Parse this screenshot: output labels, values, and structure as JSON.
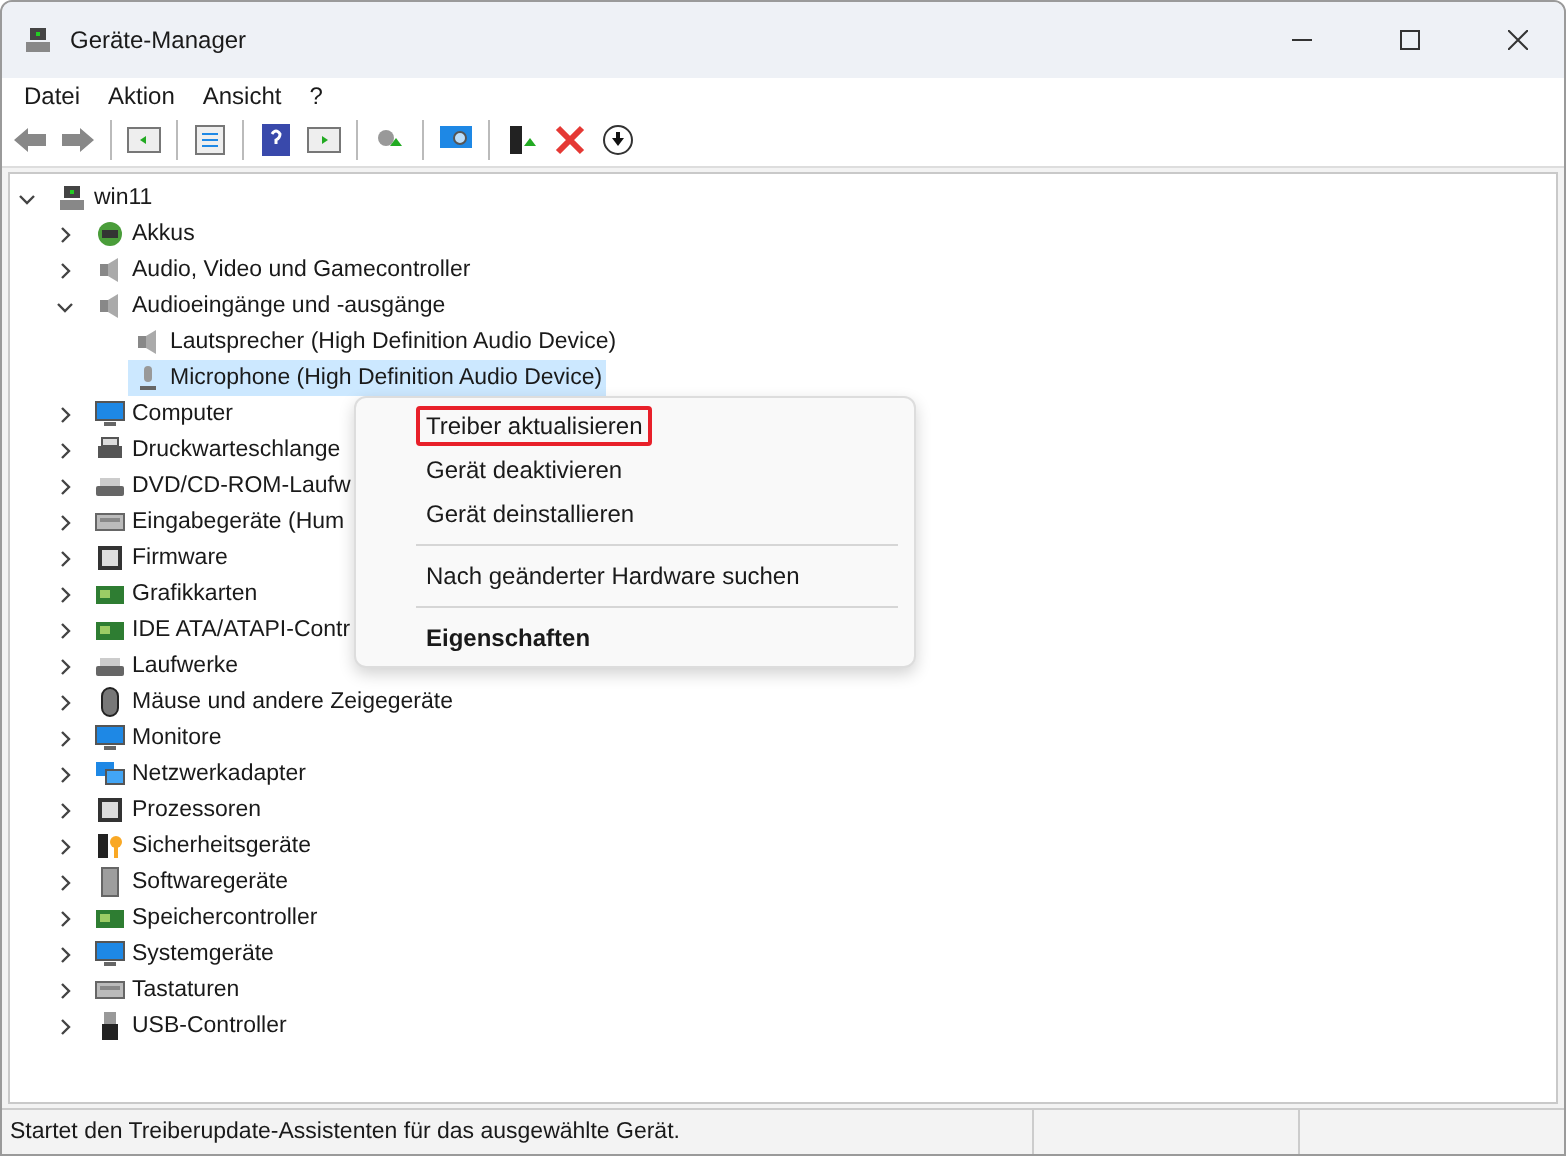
{
  "window": {
    "title": "Geräte-Manager"
  },
  "menubar": [
    "Datei",
    "Aktion",
    "Ansicht",
    "?"
  ],
  "tree": [
    {
      "label": "win11",
      "kind": "computer",
      "expanded": true,
      "selected": false,
      "children": [
        {
          "label": "Akkus",
          "kind": "battery",
          "expanded": false,
          "selected": false
        },
        {
          "label": "Audio, Video und Gamecontroller",
          "kind": "speaker",
          "expanded": false,
          "selected": false
        },
        {
          "label": "Audioeingänge und -ausgänge",
          "kind": "speaker",
          "expanded": true,
          "selected": false,
          "children": [
            {
              "label": "Lautsprecher (High Definition Audio Device)",
              "kind": "speaker",
              "selected": false
            },
            {
              "label": "Microphone (High Definition Audio Device)",
              "kind": "microphone",
              "selected": true
            }
          ]
        },
        {
          "label": "Computer",
          "kind": "monitor",
          "expanded": false,
          "selected": false
        },
        {
          "label": "Druckwarteschlange",
          "kind": "printer",
          "expanded": false,
          "selected": false
        },
        {
          "label": "DVD/CD-ROM-Laufw",
          "kind": "drive",
          "expanded": false,
          "selected": false
        },
        {
          "label": "Eingabegeräte (Hum",
          "kind": "keyboard",
          "expanded": false,
          "selected": false
        },
        {
          "label": "Firmware",
          "kind": "chip",
          "expanded": false,
          "selected": false
        },
        {
          "label": "Grafikkarten",
          "kind": "card",
          "expanded": false,
          "selected": false
        },
        {
          "label": "IDE ATA/ATAPI-Contr",
          "kind": "card",
          "expanded": false,
          "selected": false
        },
        {
          "label": "Laufwerke",
          "kind": "drive",
          "expanded": false,
          "selected": false
        },
        {
          "label": "Mäuse und andere Zeigegeräte",
          "kind": "mouse",
          "expanded": false,
          "selected": false
        },
        {
          "label": "Monitore",
          "kind": "monitor",
          "expanded": false,
          "selected": false
        },
        {
          "label": "Netzwerkadapter",
          "kind": "network",
          "expanded": false,
          "selected": false
        },
        {
          "label": "Prozessoren",
          "kind": "chip",
          "expanded": false,
          "selected": false
        },
        {
          "label": "Sicherheitsgeräte",
          "kind": "key",
          "expanded": false,
          "selected": false
        },
        {
          "label": "Softwaregeräte",
          "kind": "tower",
          "expanded": false,
          "selected": false
        },
        {
          "label": "Speichercontroller",
          "kind": "card",
          "expanded": false,
          "selected": false
        },
        {
          "label": "Systemgeräte",
          "kind": "monitor",
          "expanded": false,
          "selected": false
        },
        {
          "label": "Tastaturen",
          "kind": "keyboard",
          "expanded": false,
          "selected": false
        },
        {
          "label": "USB-Controller",
          "kind": "usb",
          "expanded": false,
          "selected": false
        }
      ]
    }
  ],
  "context_menu": [
    {
      "kind": "item",
      "label": "Treiber aktualisieren",
      "highlighted": true,
      "default": false
    },
    {
      "kind": "item",
      "label": "Gerät deaktivieren",
      "highlighted": false,
      "default": false
    },
    {
      "kind": "item",
      "label": "Gerät deinstallieren",
      "highlighted": false,
      "default": false
    },
    {
      "kind": "separator"
    },
    {
      "kind": "item",
      "label": "Nach geänderter Hardware suchen",
      "highlighted": false,
      "default": false
    },
    {
      "kind": "separator"
    },
    {
      "kind": "item",
      "label": "Eigenschaften",
      "highlighted": false,
      "default": true
    }
  ],
  "status_bar": {
    "text": "Startet den Treiberupdate-Assistenten für das ausgewählte Gerät."
  }
}
